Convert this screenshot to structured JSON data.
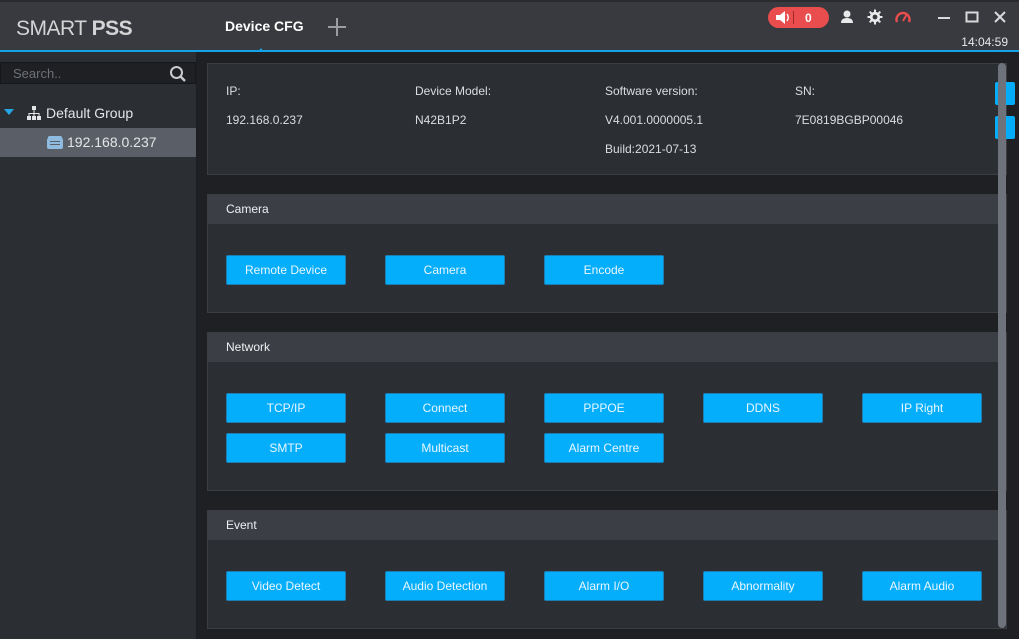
{
  "app": {
    "logo_light": "SMART",
    "logo_bold": "PSS",
    "active_tab": "Device CFG",
    "alarm_count": "0",
    "clock": "14:04:59",
    "accent_color": "#12a3e6",
    "alarm_color": "#e94d4d",
    "button_color": "#04aefb"
  },
  "sidebar": {
    "search_placeholder": "Search..",
    "group_label": "Default Group",
    "device_label": "192.168.0.237"
  },
  "device_info": {
    "ip_label": "IP:",
    "ip_value": "192.168.0.237",
    "model_label": "Device Model:",
    "model_value": "N42B1P2",
    "software_label": "Software version:",
    "software_value": "V4.001.0000005.1",
    "build_value": "Build:2021-07-13",
    "sn_label": "SN:",
    "sn_value": "7E0819BGBP00046"
  },
  "sections": {
    "camera": {
      "title": "Camera",
      "buttons": [
        "Remote Device",
        "Camera",
        "Encode"
      ]
    },
    "network": {
      "title": "Network",
      "buttons": [
        "TCP/IP",
        "Connect",
        "PPPOE",
        "DDNS",
        "IP Right",
        "SMTP",
        "Multicast",
        "Alarm Centre"
      ]
    },
    "event": {
      "title": "Event",
      "buttons": [
        "Video Detect",
        "Audio Detection",
        "Alarm I/O",
        "Abnormality",
        "Alarm Audio"
      ]
    }
  }
}
